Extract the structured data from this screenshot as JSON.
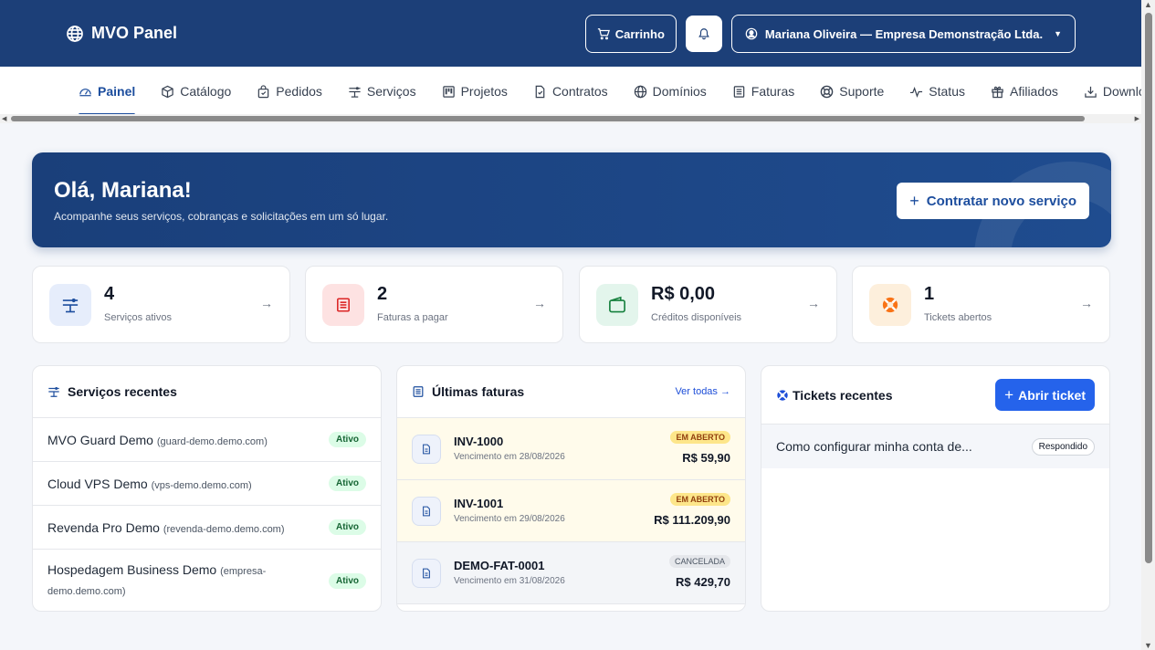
{
  "header": {
    "brand": "MVO Panel",
    "cart_label": "Carrinho",
    "user_label": "Mariana Oliveira — Empresa Demonstração Ltda.",
    "brand_color": "#1c3f78"
  },
  "nav": {
    "items": [
      {
        "label": "Painel",
        "icon": "dashboard-icon",
        "active": true
      },
      {
        "label": "Catálogo",
        "icon": "box-icon"
      },
      {
        "label": "Pedidos",
        "icon": "bag-icon"
      },
      {
        "label": "Serviços",
        "icon": "server-icon"
      },
      {
        "label": "Projetos",
        "icon": "kanban-icon"
      },
      {
        "label": "Contratos",
        "icon": "file-icon"
      },
      {
        "label": "Domínios",
        "icon": "globe-icon"
      },
      {
        "label": "Faturas",
        "icon": "receipt-icon"
      },
      {
        "label": "Suporte",
        "icon": "lifebuoy-icon"
      },
      {
        "label": "Status",
        "icon": "activity-icon"
      },
      {
        "label": "Afiliados",
        "icon": "gift-icon"
      },
      {
        "label": "Downloads",
        "icon": "download-icon"
      }
    ]
  },
  "hero": {
    "title": "Olá, Mariana!",
    "subtitle": "Acompanhe seus serviços, cobranças e solicitações em um só lugar.",
    "button_label": "Contratar novo serviço"
  },
  "stats": [
    {
      "value": "4",
      "label": "Serviços ativos",
      "icon": "server-icon"
    },
    {
      "value": "2",
      "label": "Faturas a pagar",
      "icon": "receipt-icon"
    },
    {
      "value": "R$ 0,00",
      "label": "Créditos disponíveis",
      "icon": "wallet-icon"
    },
    {
      "value": "1",
      "label": "Tickets abertos",
      "icon": "lifebuoy-icon"
    }
  ],
  "services": {
    "title": "Serviços recentes",
    "items": [
      {
        "name": "MVO Guard Demo",
        "domain": "(guard-demo.demo.com)",
        "status": "Ativo"
      },
      {
        "name": "Cloud VPS Demo",
        "domain": "(vps-demo.demo.com)",
        "status": "Ativo"
      },
      {
        "name": "Revenda Pro Demo",
        "domain": "(revenda-demo.demo.com)",
        "status": "Ativo"
      },
      {
        "name": "Hospedagem Business Demo",
        "domain": "(empresa-demo.demo.com)",
        "status": "Ativo"
      }
    ]
  },
  "invoices": {
    "title": "Últimas faturas",
    "view_all": "Ver todas →",
    "items": [
      {
        "number": "INV-1000",
        "due": "Vencimento em 28/08/2026",
        "status": "EM ABERTO",
        "amount": "R$ 59,90"
      },
      {
        "number": "INV-1001",
        "due": "Vencimento em 29/08/2026",
        "status": "EM ABERTO",
        "amount": "R$ 111.209,90"
      },
      {
        "number": "DEMO-FAT-0001",
        "due": "Vencimento em 31/08/2026",
        "status": "CANCELADA",
        "amount": "R$ 429,70"
      }
    ]
  },
  "tickets": {
    "title": "Tickets recentes",
    "button_label": "Abrir ticket",
    "items": [
      {
        "subject": "Como configurar minha conta de...",
        "status": "Respondido"
      }
    ]
  }
}
